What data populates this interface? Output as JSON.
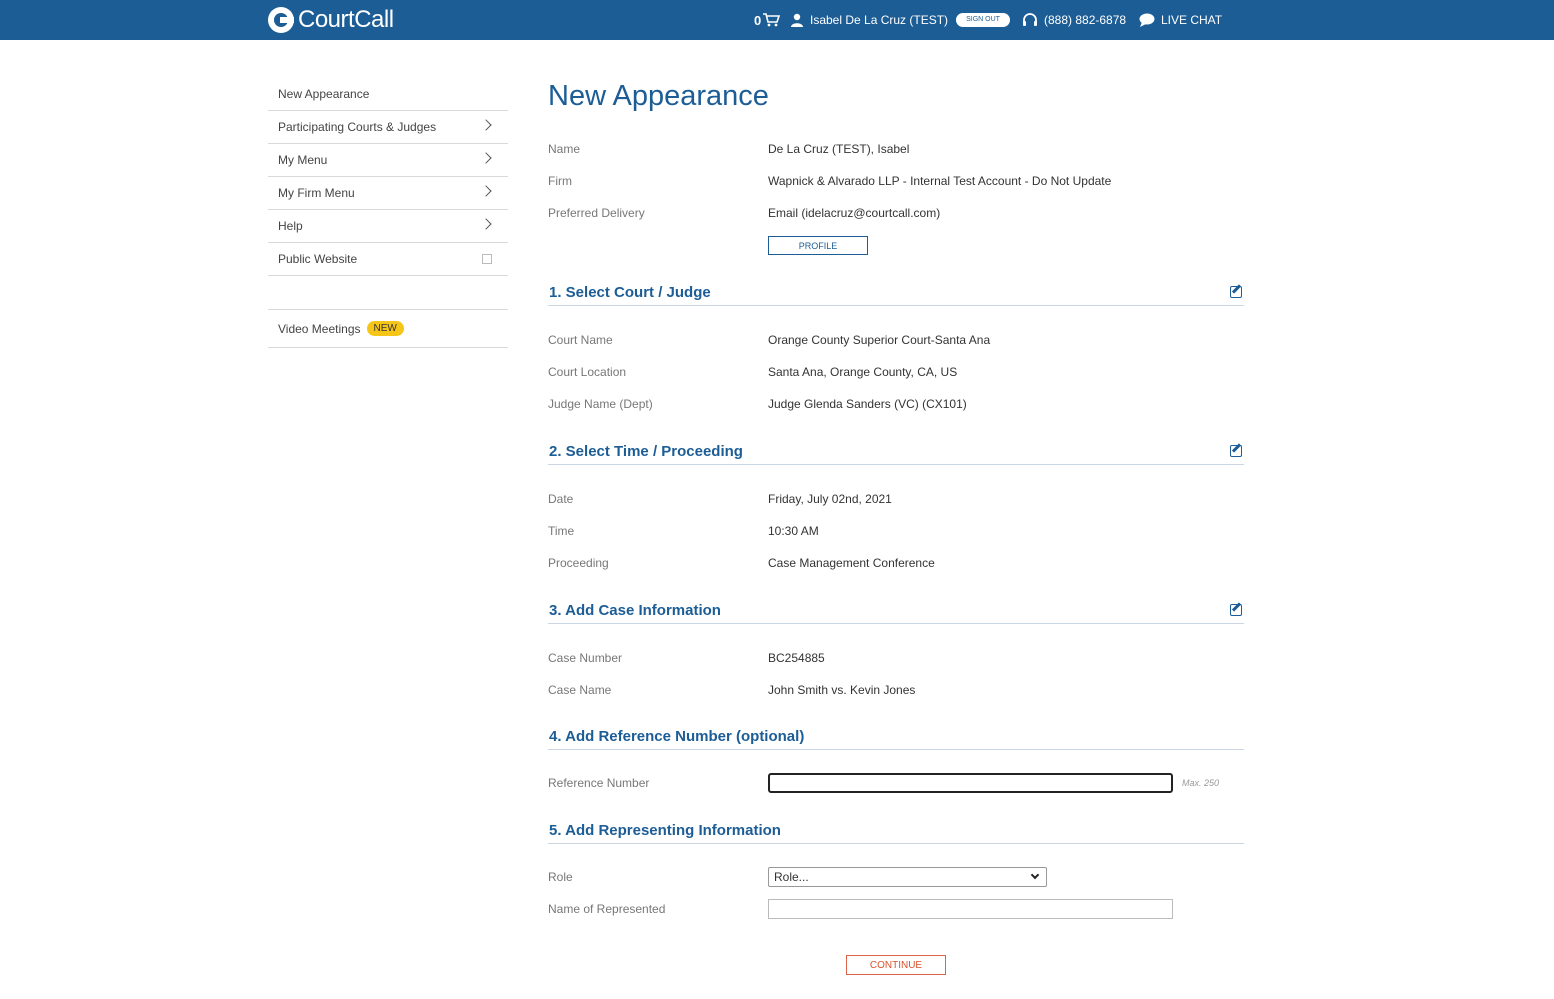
{
  "header": {
    "brand": "CourtCall",
    "cart_count": "0",
    "user_name": "Isabel De La Cruz (TEST)",
    "sign_out_label": "SIGN OUT",
    "phone": "(888) 882-6878",
    "live_chat_label": "LIVE CHAT",
    "brand_color": "#1c5d96"
  },
  "sidebar": {
    "items": [
      {
        "label": "New Appearance"
      },
      {
        "label": "Participating Courts & Judges"
      },
      {
        "label": "My Menu"
      },
      {
        "label": "My Firm Menu"
      },
      {
        "label": "Help"
      },
      {
        "label": "Public Website"
      },
      {
        "label": "Video Meetings",
        "badge": "NEW"
      }
    ]
  },
  "main": {
    "title": "New Appearance",
    "account": {
      "name_label": "Name",
      "name_value": "De La Cruz (TEST), Isabel",
      "firm_label": "Firm",
      "firm_value": "Wapnick & Alvarado LLP - Internal Test Account - Do Not Update",
      "delivery_label": "Preferred Delivery",
      "delivery_value": "Email (idelacruz@courtcall.com)",
      "profile_button": "PROFILE"
    },
    "section1": {
      "title": "1. Select Court / Judge",
      "court_name_label": "Court Name",
      "court_name_value": "Orange County Superior Court-Santa Ana",
      "court_location_label": "Court Location",
      "court_location_value": "Santa Ana, Orange County, CA, US",
      "judge_label": "Judge Name (Dept)",
      "judge_value": "Judge Glenda Sanders (VC) (CX101)"
    },
    "section2": {
      "title": "2. Select Time / Proceeding",
      "date_label": "Date",
      "date_value": "Friday, July 02nd, 2021",
      "time_label": "Time",
      "time_value": "10:30 AM",
      "proceeding_label": "Proceeding",
      "proceeding_value": "Case Management Conference"
    },
    "section3": {
      "title": "3. Add Case Information",
      "case_number_label": "Case Number",
      "case_number_value": "BC254885",
      "case_name_label": "Case Name",
      "case_name_value": "John Smith vs. Kevin Jones"
    },
    "section4": {
      "title": "4. Add Reference Number (optional)",
      "reference_label": "Reference Number",
      "reference_value": "",
      "max_note": "Max. 250"
    },
    "section5": {
      "title": "5. Add Representing Information",
      "role_label": "Role",
      "role_selected": "Role...",
      "represented_label": "Name of Represented",
      "represented_value": ""
    },
    "continue_button": "CONTINUE"
  }
}
